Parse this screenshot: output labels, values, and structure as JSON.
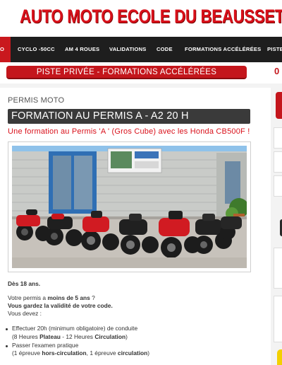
{
  "header": {
    "site_title": "AUTO MOTO ECOLE DU BEAUSSET"
  },
  "nav": {
    "items": [
      {
        "label": "O",
        "active": true
      },
      {
        "label": "CYCLO -50CC"
      },
      {
        "label": "AM 4 ROUES"
      },
      {
        "label": "VALIDATIONS"
      },
      {
        "label": "CODE"
      },
      {
        "label": "FORMATIONS ACCÉLÉRÉES"
      },
      {
        "label": "PISTE"
      }
    ]
  },
  "banner": {
    "text": "PISTE PRIVÉE - FORMATIONS ACCÉLÉRÉES",
    "right_fragment": "0"
  },
  "page": {
    "breadcrumb": "PERMIS MOTO",
    "title": "FORMATION AU PERMIS A - A2  20 H",
    "subtitle": "Une formation au Permis 'A ' (Gros Cube) avec les Honda CB500F  !",
    "age": "Dès 18 ans.",
    "p1_pre": "Votre permis a ",
    "p1_bold": "moins de 5 ans",
    "p1_post": " ?",
    "p2": "Vous gardez la validité de votre code.",
    "p3": "Vous devez :",
    "b1_line1": "Effectuer 20h (minimum obligatoire) de conduite",
    "b1_l2_pre": "(8 Heures ",
    "b1_l2_b1": "Plateau",
    "b1_l2_mid": " - 12 Heures ",
    "b1_l2_b2": "Circulation",
    "b1_l2_post": ")",
    "b2_line1": "Passer l'examen pratique",
    "b2_l2_pre": "(1 épreuve ",
    "b2_l2_b1": "hors-circulation",
    "b2_l2_mid": ", 1 épreuve ",
    "b2_l2_b2": "circulation",
    "b2_l2_post": ")"
  },
  "colors": {
    "brand_red": "#c4161c",
    "nav_bg": "#1e1e1e",
    "title_bar": "#3a3a3a"
  },
  "photo": {
    "alt": "Honda CB500F motorcycles parked in front of the driving school"
  }
}
